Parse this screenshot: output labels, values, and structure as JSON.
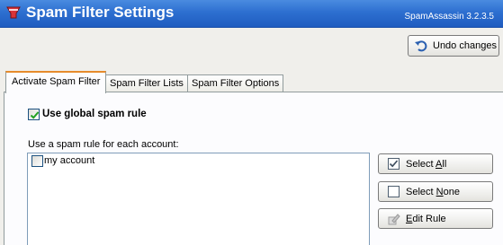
{
  "window": {
    "title": "Spam Filter Settings",
    "version": "SpamAssassin 3.2.3.5",
    "icon": "spam-filter-icon"
  },
  "toolbar": {
    "undo_label": "Undo changes",
    "undo_icon": "undo-icon"
  },
  "tabs": [
    {
      "label": "Activate Spam Filter",
      "active": true
    },
    {
      "label": "Spam Filter Lists",
      "active": false
    },
    {
      "label": "Spam Filter Options",
      "active": false
    }
  ],
  "activate": {
    "global_rule_label": "Use global spam rule",
    "global_rule_checked": true,
    "per_account_label": "Use a spam rule for each account:",
    "accounts": [
      {
        "label": "my account",
        "checked": false
      }
    ]
  },
  "actions": {
    "select_all": {
      "prefix": "Select ",
      "underline": "A",
      "suffix": "ll",
      "icon": "checked-box-icon"
    },
    "select_none": {
      "prefix": "Select ",
      "underline": "N",
      "suffix": "one",
      "icon": "empty-box-icon"
    },
    "edit_rule": {
      "prefix": "",
      "underline": "E",
      "suffix": "dit Rule",
      "icon": "edit-rule-icon",
      "enabled": false
    }
  },
  "colors": {
    "titlebar": "#2d6fd0",
    "active_tab_accent": "#e68b2c",
    "check_color": "#21a121"
  }
}
